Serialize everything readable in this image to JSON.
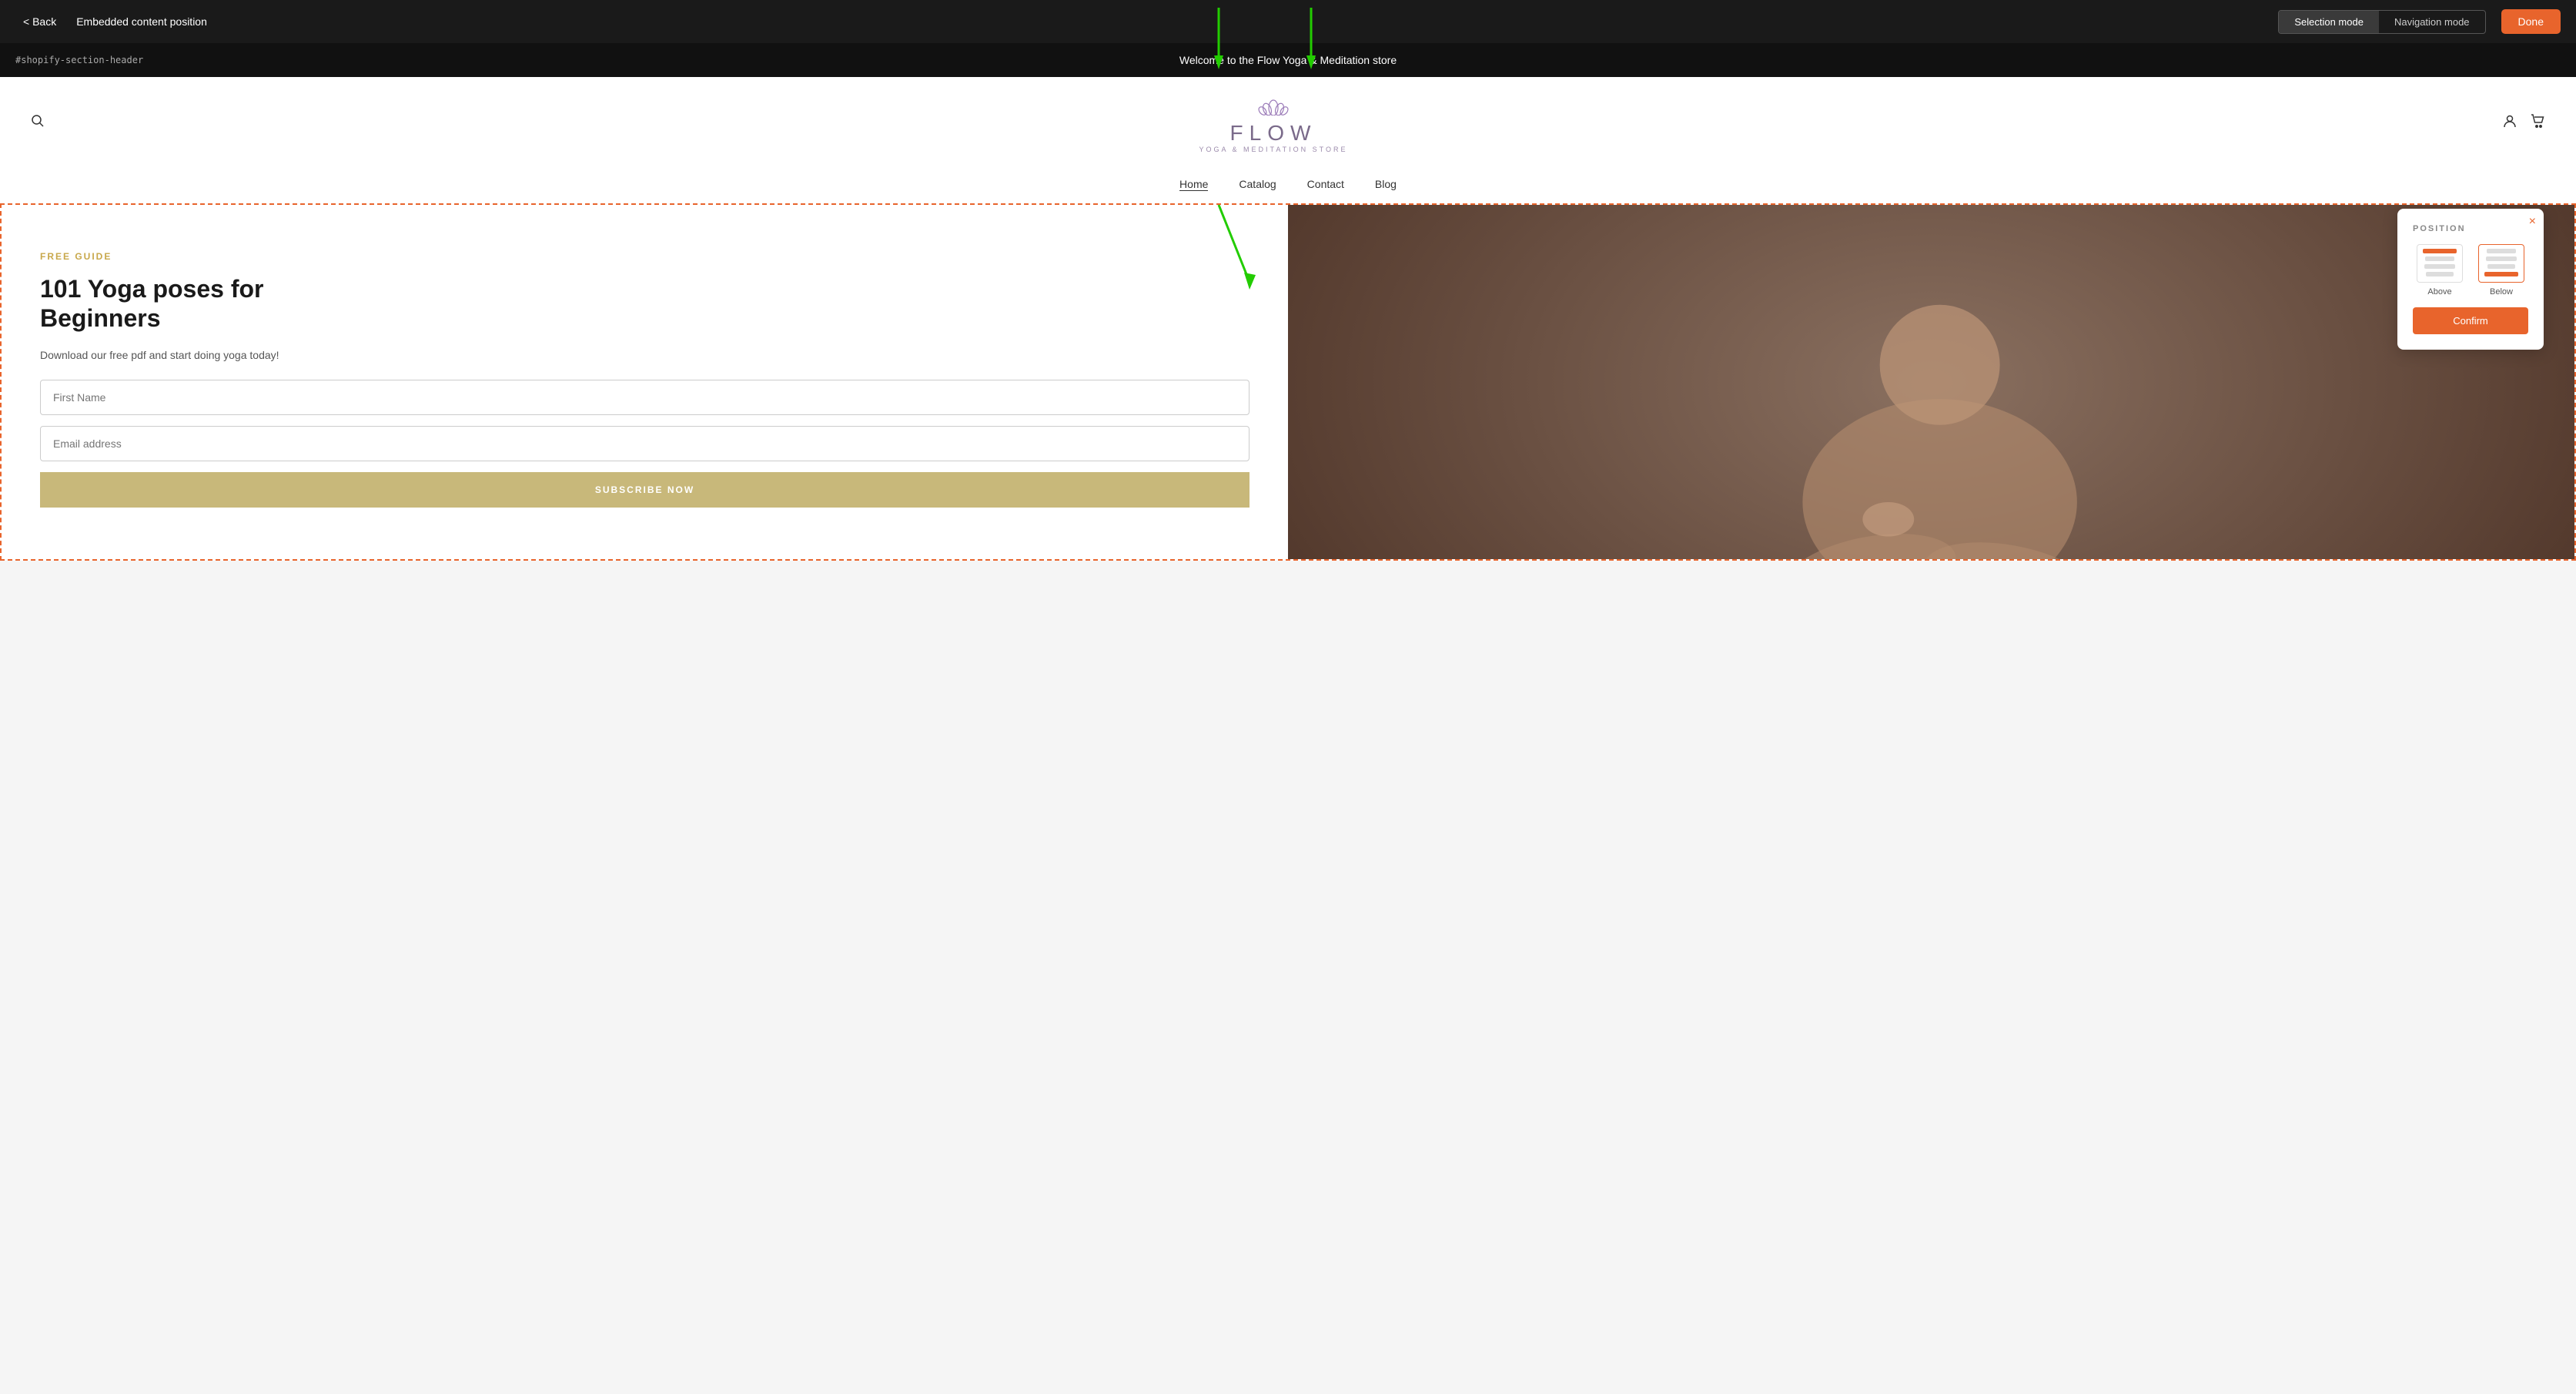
{
  "topBar": {
    "backLabel": "< Back",
    "title": "Embedded content position",
    "selectionModeLabel": "Selection mode",
    "navigationModeLabel": "Navigation mode",
    "doneLabel": "Done"
  },
  "announcementBar": {
    "sectionId": "#shopify-section-header",
    "message": "Welcome to the Flow Yoga & Meditation store"
  },
  "storeLogo": {
    "lotusSymbol": "⚘",
    "name": "FLOW",
    "subtitle": "YOGA & MEDITATION STORE"
  },
  "headerIcons": {
    "searchSymbol": "🔍",
    "accountSymbol": "👤",
    "cartSymbol": "🛒"
  },
  "nav": {
    "links": [
      {
        "label": "Home",
        "active": true
      },
      {
        "label": "Catalog",
        "active": false
      },
      {
        "label": "Contact",
        "active": false
      },
      {
        "label": "Blog",
        "active": false
      }
    ]
  },
  "formSection": {
    "freeGuideLabel": "FREE GUIDE",
    "heading1": "101 Yoga poses for",
    "heading2": "Beginners",
    "description": "Download our free pdf and start doing yoga today!",
    "firstNamePlaceholder": "First Name",
    "emailPlaceholder": "Email address",
    "subscribeBtnLabel": "SUBSCRIBE NOW"
  },
  "positionPopup": {
    "title": "POSITION",
    "aboveLabel": "Above",
    "belowLabel": "Below",
    "confirmLabel": "Confirm",
    "closeSymbol": "×"
  }
}
